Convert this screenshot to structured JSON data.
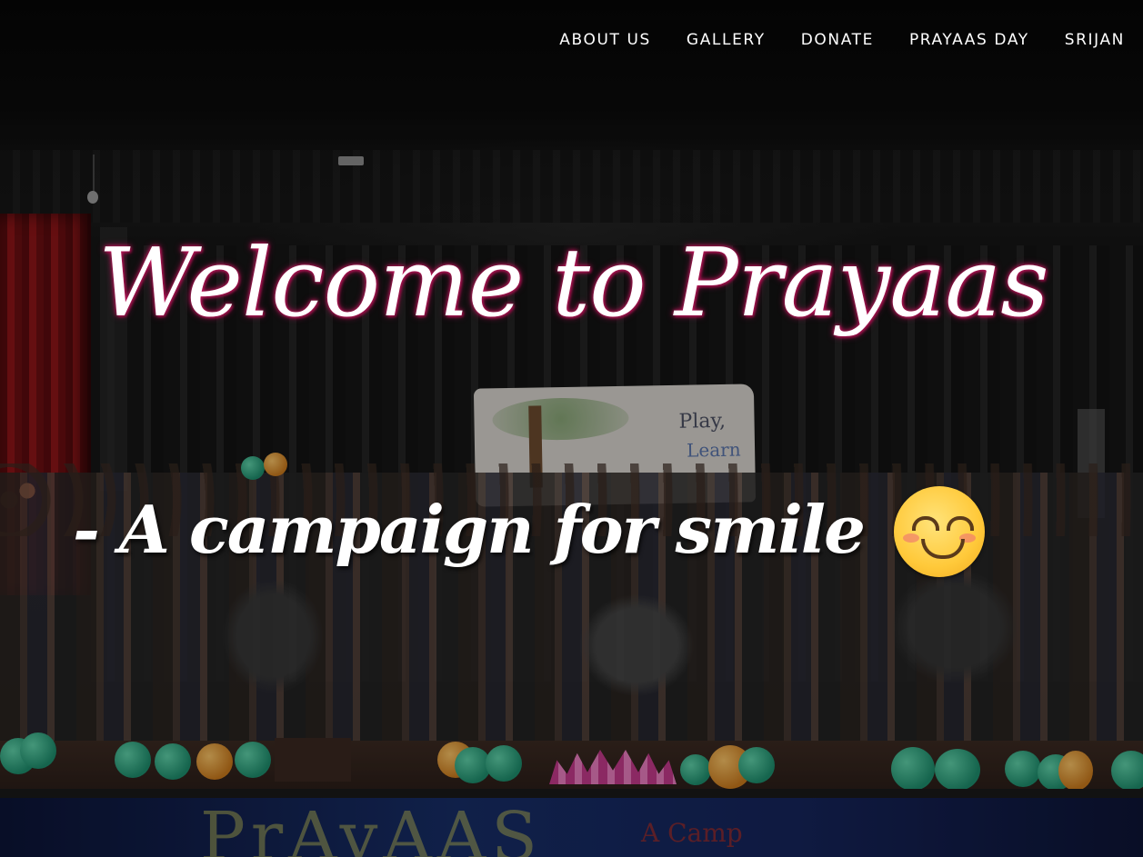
{
  "nav": {
    "items": [
      "ABOUT US",
      "GALLERY",
      "DONATE",
      "PRAYAAS DAY",
      "SRIJAN"
    ]
  },
  "hero": {
    "title": "Welcome to Prayaas",
    "subtitle": "- A campaign for smile",
    "emoji_icon": "smiling-face-icon",
    "banner_text_1": "Play,",
    "banner_text_2": "Learn",
    "stage_banner_text": "PrAyAAS",
    "stage_banner_text_2": "A Camp"
  },
  "colors": {
    "title_glow": "#c2185b",
    "text": "#ffffff",
    "background": "#050505"
  }
}
